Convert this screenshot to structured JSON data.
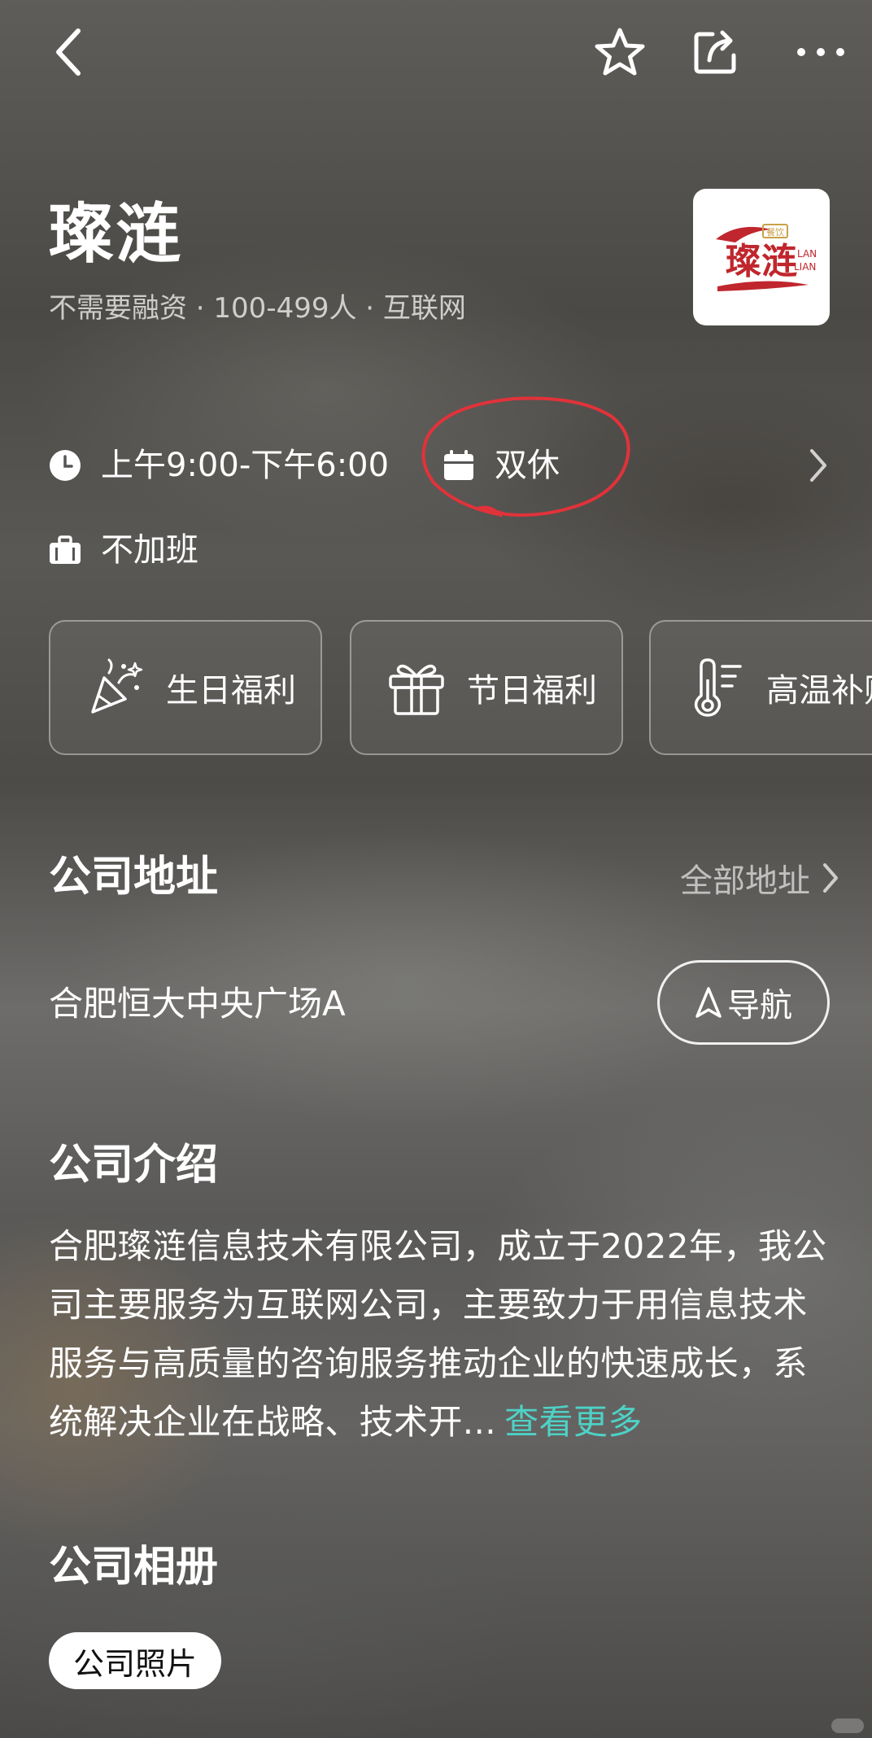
{
  "header": {
    "back_icon": "back-arrow-icon",
    "favorite_icon": "star-icon",
    "share_icon": "share-icon",
    "more_icon": "more-icon"
  },
  "company": {
    "name": "璨涟",
    "meta": "不需要融资 · 100-499人 · 互联网",
    "logo_text": "璨涟",
    "logo_sub1": "LAN",
    "logo_sub2": "LIAN",
    "logo_badge": "餐饮",
    "brand_color": "#c0262d"
  },
  "work_info": {
    "hours": "上午9:00-下午6:00",
    "rest": "双休",
    "overtime": "不加班",
    "highlight_color": "#e2323a"
  },
  "benefits": [
    {
      "label": "生日福利",
      "icon": "party-popper-icon"
    },
    {
      "label": "节日福利",
      "icon": "gift-icon"
    },
    {
      "label": "高温补贴",
      "icon": "thermometer-icon"
    }
  ],
  "address": {
    "title": "公司地址",
    "all_label": "全部地址",
    "location": "合肥恒大中央广场A",
    "nav_label": "导航"
  },
  "intro": {
    "title": "公司介绍",
    "text": "合肥璨涟信息技术有限公司，成立于2022年，我公司主要服务为互联网公司，主要致力于用信息技术服务与高质量的咨询服务推动企业的快速成长，系统解决企业在战略、技术开...",
    "more_label": "查看更多",
    "more_color": "#4fd1c5"
  },
  "album": {
    "title": "公司相册",
    "chip_label": "公司照片"
  }
}
